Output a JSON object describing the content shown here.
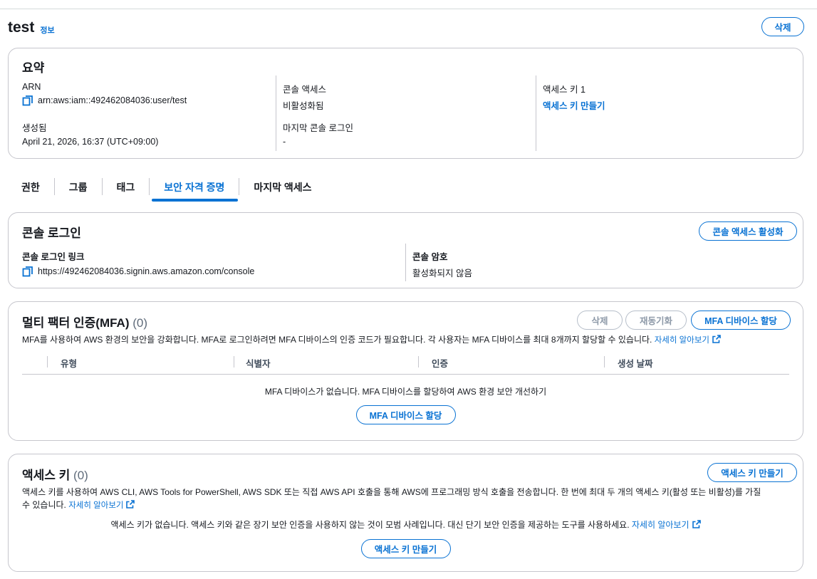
{
  "header": {
    "title": "test",
    "info": "정보",
    "delete_label": "삭제"
  },
  "summary": {
    "title": "요약",
    "arn_label": "ARN",
    "arn_value": "arn:aws:iam::492462084036:user/test",
    "created_label": "생성됨",
    "created_value": "April 21, 2026, 16:37 (UTC+09:00)",
    "console_access_label": "콘솔 액세스",
    "console_access_value": "비활성화됨",
    "last_console_label": "마지막 콘솔 로그인",
    "last_console_value": "-",
    "access_key_label": "액세스 키 1",
    "access_key_link": "액세스 키 만들기"
  },
  "tabs": [
    {
      "label": "권한"
    },
    {
      "label": "그룹"
    },
    {
      "label": "태그"
    },
    {
      "label": "보안 자격 증명"
    },
    {
      "label": "마지막 액세스"
    }
  ],
  "console_signin": {
    "title": "콘솔 로그인",
    "enable_button": "콘솔 액세스 활성화",
    "link_label": "콘솔 로그인 링크",
    "link_value": "https://492462084036.signin.aws.amazon.com/console",
    "password_label": "콘솔 암호",
    "password_value": "활성화되지 않음"
  },
  "mfa": {
    "title": "멀티 팩터 인증(MFA)",
    "count": "(0)",
    "delete_button": "삭제",
    "resync_button": "재동기화",
    "assign_button": "MFA 디바이스 할당",
    "description": "MFA를 사용하여 AWS 환경의 보안을 강화합니다. MFA로 로그인하려면 MFA 디바이스의 인증 코드가 필요합니다. 각 사용자는 MFA 디바이스를 최대 8개까지 할당할 수 있습니다.",
    "learn_more": "자세히 알아보기",
    "columns": [
      "유형",
      "식별자",
      "인증",
      "생성 날짜"
    ],
    "empty_message": "MFA 디바이스가 없습니다. MFA 디바이스를 할당하여 AWS 환경 보안 개선하기",
    "empty_button": "MFA 디바이스 할당"
  },
  "access_keys": {
    "title": "액세스 키",
    "count": "(0)",
    "create_button": "액세스 키 만들기",
    "description_line1": "액세스 키를 사용하여 AWS CLI, AWS Tools for PowerShell, AWS SDK 또는 직접 AWS API 호출을 통해 AWS에 프로그래밍 방식 호출을 전송합니다. 한 번에 최대 두 개의 액세스 키(활성 또는 비활성)를 가질",
    "description_line2": "수 있습니다.",
    "learn_more": "자세히 알아보기",
    "empty_message": "액세스 키가 없습니다. 액세스 키와 같은 장기 보안 인증을 사용하지 않는 것이 모범 사례입니다. 대신 단기 보안 인증을 제공하는 도구를 사용하세요.",
    "empty_learn_more": "자세히 알아보기",
    "empty_button": "액세스 키 만들기"
  }
}
